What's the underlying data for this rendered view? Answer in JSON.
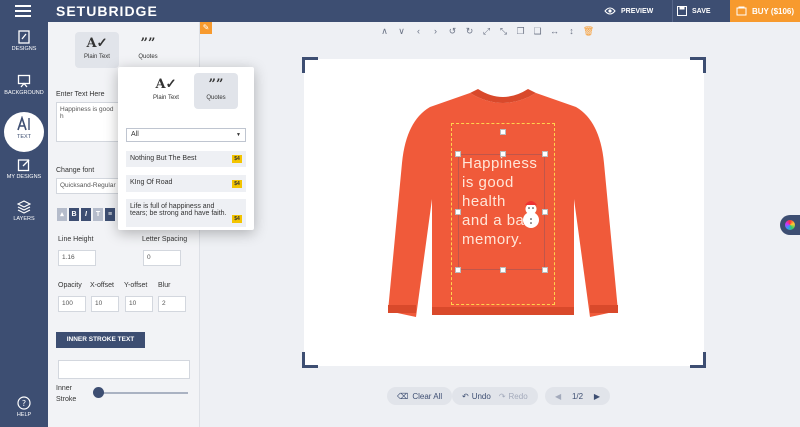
{
  "app": {
    "logo": "SETUBRIDGE"
  },
  "topbar": {
    "preview": "PREVIEW",
    "save": "SAVE",
    "buy": "BUY ($106)"
  },
  "rail": [
    {
      "label": "DESIGNS"
    },
    {
      "label": "BACKGROUND"
    },
    {
      "label": "TEXT"
    },
    {
      "label": "MY DESIGNS"
    },
    {
      "label": "LAYERS"
    },
    {
      "label": "HELP"
    }
  ],
  "panel": {
    "tab_plain": "Plain Text",
    "tab_quotes": "Quotes",
    "enter_text_label": "Enter Text Here",
    "enter_text_value": "Happiness is good h",
    "change_font_label": "Change font",
    "font_value": "Quicksand-Regular",
    "line_height_label": "Line Height",
    "line_height_value": "1.16",
    "letter_spacing_label": "Letter Spacing",
    "letter_spacing_value": "0",
    "opacity_label": "Opacity",
    "opacity_value": "100",
    "xoffset_label": "X-offset",
    "xoffset_value": "10",
    "yoffset_label": "Y-offset",
    "yoffset_value": "10",
    "blur_label": "Blur",
    "blur_value": "2",
    "inner_stroke_btn": "INNER STROKE TEXT",
    "inner_label_1": "Inner",
    "inner_label_2": "Stroke",
    "inner_stroke_level": 0.05
  },
  "popup": {
    "tab_plain": "Plain Text",
    "tab_quotes": "Quotes",
    "select_value": "All",
    "quotes": [
      {
        "text": "Nothing But The Best",
        "badge": "$4"
      },
      {
        "text": "KIng Of Road",
        "badge": "$4"
      },
      {
        "text": "Life is full of happiness and tears; be strong and have faith.",
        "badge": "$4"
      }
    ]
  },
  "canvas": {
    "design_lines": [
      "Happiness",
      "is good",
      "health",
      "and a bad",
      "memory."
    ],
    "shirt_color": "#f05a3a"
  },
  "bottom": {
    "clear": "Clear All",
    "undo": "Undo",
    "redo": "Redo",
    "page": "1/2"
  },
  "colors": {
    "primary": "#3d4e72",
    "accent": "#f79a2e"
  }
}
